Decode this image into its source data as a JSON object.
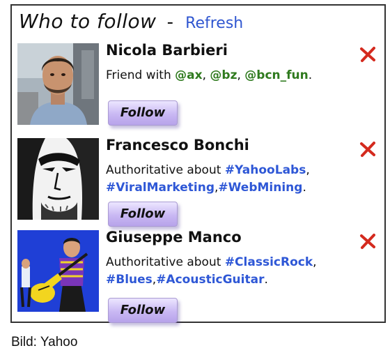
{
  "header": {
    "title": "Who to follow",
    "separator": "-",
    "refresh_label": "Refresh"
  },
  "suggestions": [
    {
      "name": "Nicola Barbieri",
      "desc_prefix": "Friend with ",
      "desc_parts": [
        {
          "text": "@ax",
          "style": "green"
        },
        {
          "text": ", ",
          "style": "plain"
        },
        {
          "text": "@bz",
          "style": "green"
        },
        {
          "text": ", ",
          "style": "plain"
        },
        {
          "text": "@bcn_fun",
          "style": "green"
        },
        {
          "text": ".",
          "style": "plain"
        }
      ],
      "follow_label": "Follow",
      "avatar_icon": "portrait-photo-outdoor"
    },
    {
      "name": "Francesco Bonchi",
      "desc_prefix": "Authoritative about ",
      "desc_parts": [
        {
          "text": "#YahooLabs",
          "style": "blue"
        },
        {
          "text": ", ",
          "style": "plain"
        },
        {
          "text": "#ViralMarketing",
          "style": "blue"
        },
        {
          "text": ",",
          "style": "plain"
        },
        {
          "text": "#WebMining",
          "style": "blue"
        },
        {
          "text": ".",
          "style": "plain"
        }
      ],
      "follow_label": "Follow",
      "avatar_icon": "portrait-bw-drawing"
    },
    {
      "name": "Giuseppe Manco",
      "desc_prefix": "Authoritative about ",
      "desc_parts": [
        {
          "text": "#ClassicRock",
          "style": "blue"
        },
        {
          "text": ", ",
          "style": "plain"
        },
        {
          "text": "#Blues",
          "style": "blue"
        },
        {
          "text": ",",
          "style": "plain"
        },
        {
          "text": "#AcousticGuitar",
          "style": "blue"
        },
        {
          "text": ".",
          "style": "plain"
        }
      ],
      "follow_label": "Follow",
      "avatar_icon": "guitarist-pop-art"
    }
  ],
  "caption": "Bild: Yahoo",
  "colors": {
    "mention_green": "#2f7a1e",
    "hashtag_blue": "#2e57d6",
    "refresh_blue": "#2f56d0",
    "follow_purple": "#c9b8f3",
    "dismiss_red": "#d42a1e"
  }
}
